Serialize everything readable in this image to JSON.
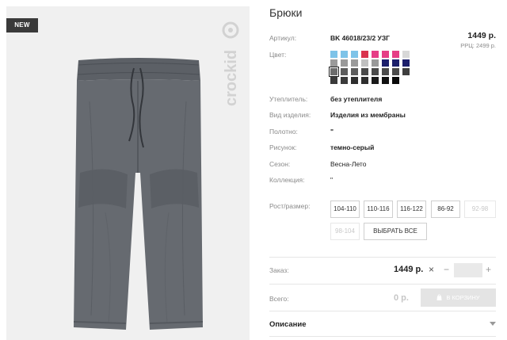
{
  "badge": {
    "label": "NEW"
  },
  "brand": {
    "name": "crockid"
  },
  "product": {
    "title": "Брюки",
    "article_label": "Артикул:",
    "article_value": "BK 46018/23/2 УЗГ",
    "price": "1449 р.",
    "rrc": "РРЦ: 2499 р.",
    "color_label": "Цвет:",
    "colors": [
      [
        "#7ec3e8",
        "#7ec3e8",
        "#7ec3e8",
        "#d9334d",
        "#e63d86",
        "#e63d86",
        "#e63d86",
        "#d8d8d8"
      ],
      [
        "#9a9a9a",
        "#9a9a9a",
        "#9a9a9a",
        "#c0c0c0",
        "#9a9a9a",
        "#1c1f6b",
        "#1c1f6b",
        "#1c1f6b"
      ],
      [
        "#6c6c6c",
        "#5c5c5c",
        "#5c5c5c",
        "#4a4a4a",
        "#4a4a4a",
        "#4a4a4a",
        "#4a4a4a",
        "#3e3e3e"
      ],
      [
        "#3a3a3a",
        "#3a3a3a",
        "#2e2e2e",
        "#2e2e2e",
        "#1a1a1a",
        "#111111",
        "#0a0a0a",
        null
      ]
    ],
    "selected_color": "2-0",
    "properties": [
      {
        "label": "Утеплитель:",
        "value": "без утеплителя",
        "bold": true
      },
      {
        "label": "Вид изделия:",
        "value": "Изделия из мембраны",
        "bold": true
      },
      {
        "label": "Полотно:",
        "value": "\"",
        "bold": true
      },
      {
        "label": "Рисунок:",
        "value": "темно-серый",
        "bold": true
      },
      {
        "label": "Сезон:",
        "value": "Весна-Лето",
        "bold": false
      },
      {
        "label": "Коллекция:",
        "value": "\"",
        "bold": false
      }
    ],
    "size_label": "Рост/размер:",
    "sizes": [
      {
        "label": "104-110",
        "available": true
      },
      {
        "label": "110-116",
        "available": true
      },
      {
        "label": "116-122",
        "available": true
      },
      {
        "label": "86-92",
        "available": true
      },
      {
        "label": "92-98",
        "available": false
      },
      {
        "label": "98-104",
        "available": false
      }
    ],
    "select_all": "ВЫБРАТЬ ВСЕ"
  },
  "order": {
    "label": "Заказ:",
    "price": "1449 р.",
    "times": "×",
    "minus": "−",
    "plus": "+",
    "quantity": ""
  },
  "total": {
    "label": "Всего:",
    "value": "0 р.",
    "cart_button": "В КОРЗИНУ"
  },
  "description": {
    "label": "Описание"
  },
  "icons": {
    "cart": "shopping-bag-icon",
    "caret": "chevron-down-icon"
  }
}
